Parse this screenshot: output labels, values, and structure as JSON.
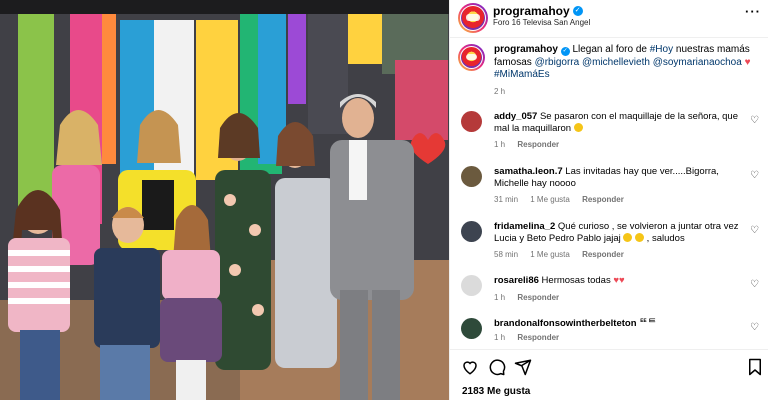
{
  "post": {
    "username": "programahoy",
    "location": "Foro 16 Televisa San Angel",
    "image_alt": "Group photo of hosts and guests with children on a colorful TV studio set",
    "caption": {
      "username": "programahoy",
      "lead": " Llegan al foro de ",
      "hashtag1": "#Hoy",
      "mid1": " nuestras mamás famosas ",
      "mention1": "@rbigorra",
      "mention2": "@michellevieth",
      "mention3": "@soymarianaochoa",
      "hashtag2": "#MiMamáEs",
      "time": "2 h"
    },
    "likes_label": "2183 Me gusta"
  },
  "comments": [
    {
      "username": "addy_057",
      "text": "Se pasaron con el maquillaje de la señora, que mal la maquillaron",
      "time": "1 h",
      "likes": "",
      "reply": "Responder",
      "avatar_color": "#b53a3a"
    },
    {
      "username": "samatha.leon.7",
      "text": "Las invitadas hay que ver.....Bigorra, Michelle hay noooo",
      "time": "31 min",
      "likes": "1 Me gusta",
      "reply": "Responder",
      "avatar_color": "#6b5a3e"
    },
    {
      "username": "fridamelina_2",
      "text": "Qué curioso , se volvieron a juntar otra vez Lucia y Beto Pedro Pablo jajaj",
      "text_end": ", saludos",
      "time": "58 min",
      "likes": "1 Me gusta",
      "reply": "Responder",
      "avatar_color": "#3d4450"
    },
    {
      "username": "rosareli86",
      "text": "Hermosas todas",
      "time": "1 h",
      "likes": "",
      "reply": "Responder",
      "avatar_color": "#dbdbdb"
    },
    {
      "username": "brandonalfonsowintherbelteton",
      "text": "ᄐᄐᄐ",
      "time": "1 h",
      "likes": "",
      "reply": "Responder",
      "avatar_color": "#2e4a3a"
    }
  ],
  "colors": {
    "link": "#00376b",
    "meta": "#737373",
    "heart": "#ed4956",
    "verified": "#0095f6"
  },
  "icons": [
    "heart-icon",
    "comment-icon",
    "share-icon",
    "bookmark-icon",
    "more-icon",
    "verified-icon"
  ]
}
